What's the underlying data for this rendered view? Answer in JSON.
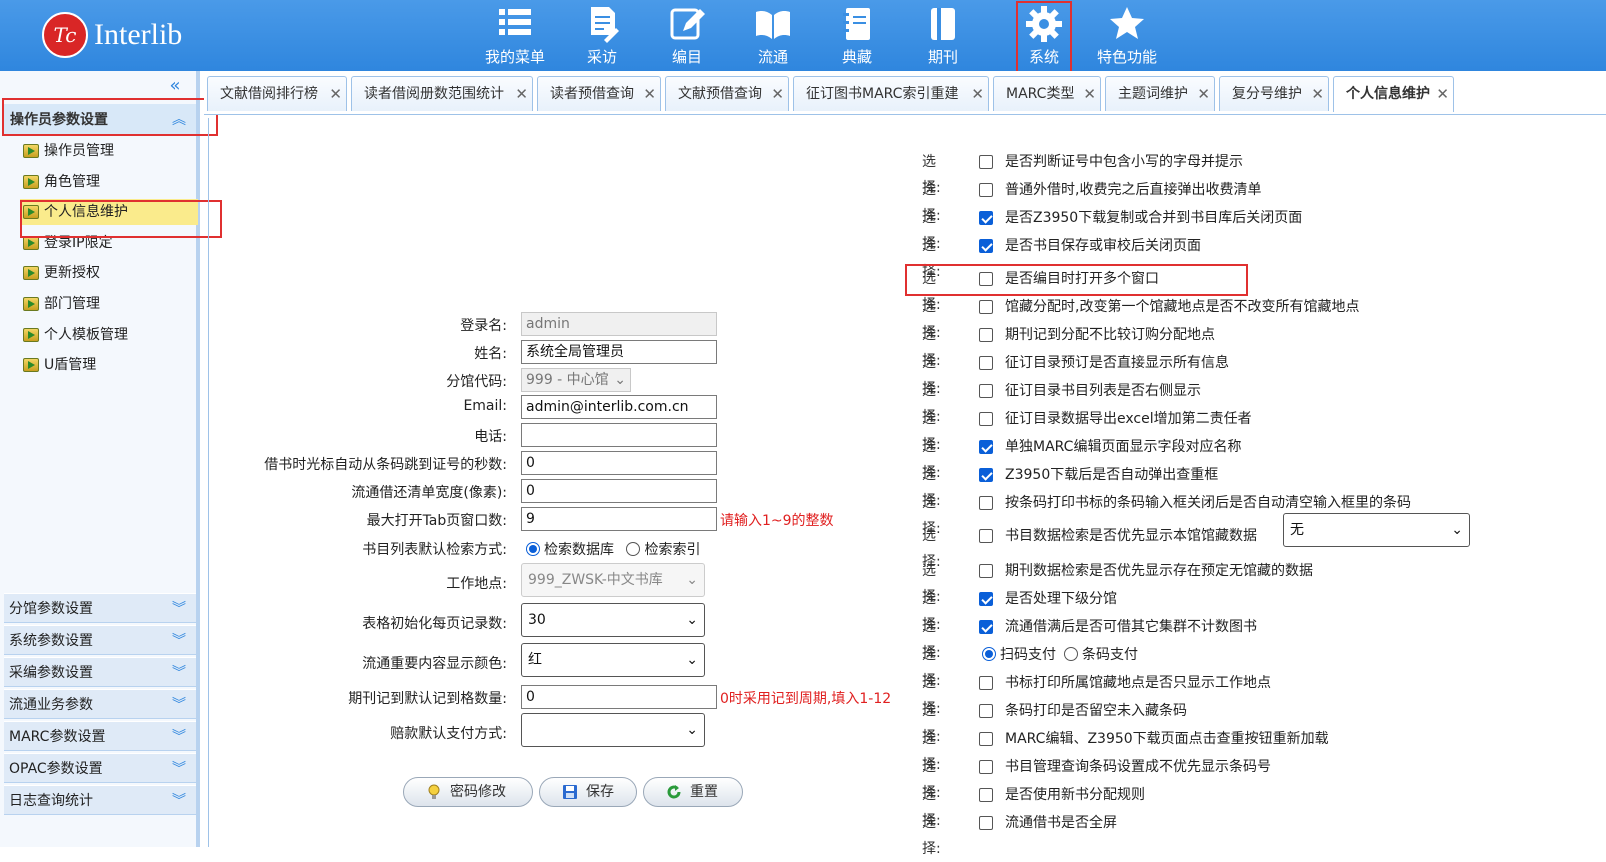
{
  "app": {
    "logo_mark": "Tc",
    "logo_text": "Interlib"
  },
  "nav": [
    {
      "label": "我的菜单",
      "icon": "list-icon"
    },
    {
      "label": "采访",
      "icon": "document-edit-icon"
    },
    {
      "label": "编目",
      "icon": "pencil-square-icon"
    },
    {
      "label": "流通",
      "icon": "open-book-icon"
    },
    {
      "label": "典藏",
      "icon": "notebook-icon"
    },
    {
      "label": "期刊",
      "icon": "journal-icon"
    },
    {
      "label": "系统",
      "icon": "gear-icon"
    },
    {
      "label": "特色功能",
      "icon": "star-icon"
    }
  ],
  "sidebar": {
    "collapse_glyph": "«",
    "section": "操作员参数设置",
    "items": [
      "操作员管理",
      "角色管理",
      "个人信息维护",
      "登录IP限定",
      "更新授权",
      "部门管理",
      "个人模板管理",
      "U盾管理"
    ],
    "active_item": "个人信息维护",
    "groups": [
      "分馆参数设置",
      "系统参数设置",
      "采编参数设置",
      "流通业务参数",
      "MARC参数设置",
      "OPAC参数设置",
      "日志查询统计"
    ]
  },
  "tabs": [
    "文献借阅排行榜",
    "读者借阅册数范围统计",
    "读者预借查询",
    "文献预借查询",
    "征订图书MARC索引重建",
    "MARC类型",
    "主题词维护",
    "复分号维护",
    "个人信息维护"
  ],
  "active_tab": "个人信息维护",
  "form": {
    "login_label": "登录名:",
    "login_value": "admin",
    "name_label": "姓名:",
    "name_value": "系统全局管理员",
    "branch_label": "分馆代码:",
    "branch_value": "999 - 中心馆",
    "email_label": "Email:",
    "email_value": "admin@interlib.com.cn",
    "phone_label": "电话:",
    "phone_value": "",
    "seconds_label": "借书时光标自动从条码跳到证号的秒数:",
    "seconds_value": "0",
    "width_label": "流通借还清单宽度(像素):",
    "width_value": "0",
    "maxtab_label": "最大打开Tab页窗口数:",
    "maxtab_value": "9",
    "maxtab_hint": "请输入1~9的整数",
    "search_label": "书目列表默认检索方式:",
    "search_opt1": "检索数据库",
    "search_opt2": "检索索引",
    "location_label": "工作地点:",
    "location_value": "999_ZWSK-中文书库",
    "pagesize_label": "表格初始化每页记录数:",
    "pagesize_value": "30",
    "color_label": "流通重要内容显示颜色:",
    "color_value": "红",
    "period_label": "期刊记到默认记到格数量:",
    "period_value": "0",
    "period_hint": "0时采用记到周期,填入1-12",
    "pay_label": "赔款默认支付方式:",
    "pay_value": "",
    "btn_password": "密码修改",
    "btn_save": "保存",
    "btn_reset": "重置"
  },
  "option_prefix": "选择:",
  "options": [
    {
      "text": "是否判断证号中包含小写的字母并提示",
      "checked": false
    },
    {
      "text": "普通外借时,收费完之后直接弹出收费清单",
      "checked": false
    },
    {
      "text": "是否Z3950下载复制或合并到书目库后关闭页面",
      "checked": true
    },
    {
      "text": "是否书目保存或审校后关闭页面",
      "checked": true
    },
    {
      "text": "是否编目时打开多个窗口",
      "checked": false
    },
    {
      "text": "馆藏分配时,改变第一个馆藏地点是否不改变所有馆藏地点",
      "checked": false
    },
    {
      "text": "期刊记到分配不比较订购分配地点",
      "checked": false
    },
    {
      "text": "征订目录预订是否直接显示所有信息",
      "checked": false
    },
    {
      "text": "征订目录书目列表是否右侧显示",
      "checked": false
    },
    {
      "text": "征订目录数据导出excel增加第二责任者",
      "checked": false
    },
    {
      "text": "单独MARC编辑页面显示字段对应名称",
      "checked": true
    },
    {
      "text": "Z3950下载后是否自动弹出查重框",
      "checked": true
    },
    {
      "text": "按条码打印书标的条码输入框关闭后是否自动清空输入框里的条码",
      "checked": false
    },
    {
      "text": "书目数据检索是否优先显示本馆馆藏数据",
      "checked": false,
      "select": "无"
    },
    {
      "text": "期刊数据检索是否优先显示存在预定无馆藏的数据",
      "checked": false
    },
    {
      "text": "是否处理下级分馆",
      "checked": true
    },
    {
      "text": "流通借满后是否可借其它集群不计数图书",
      "checked": true
    },
    {
      "radio": true,
      "opt1": "扫码支付",
      "opt2": "条码支付"
    },
    {
      "text": "书标打印所属馆藏地点是否只显示工作地点",
      "checked": false
    },
    {
      "text": "条码打印是否留空未入藏条码",
      "checked": false
    },
    {
      "text": "MARC编辑、Z3950下载页面点击查重按钮重新加载",
      "checked": false
    },
    {
      "text": "书目管理查询条码设置成不优先显示条码号",
      "checked": false
    },
    {
      "text": "是否使用新书分配规则",
      "checked": false
    },
    {
      "text": "流通借书是否全屏",
      "checked": false
    }
  ],
  "colors": {
    "topbar": "#2f86de",
    "highlight": "#e03030",
    "active_item_bg": "#faeb8c",
    "hint": "#e02020"
  }
}
